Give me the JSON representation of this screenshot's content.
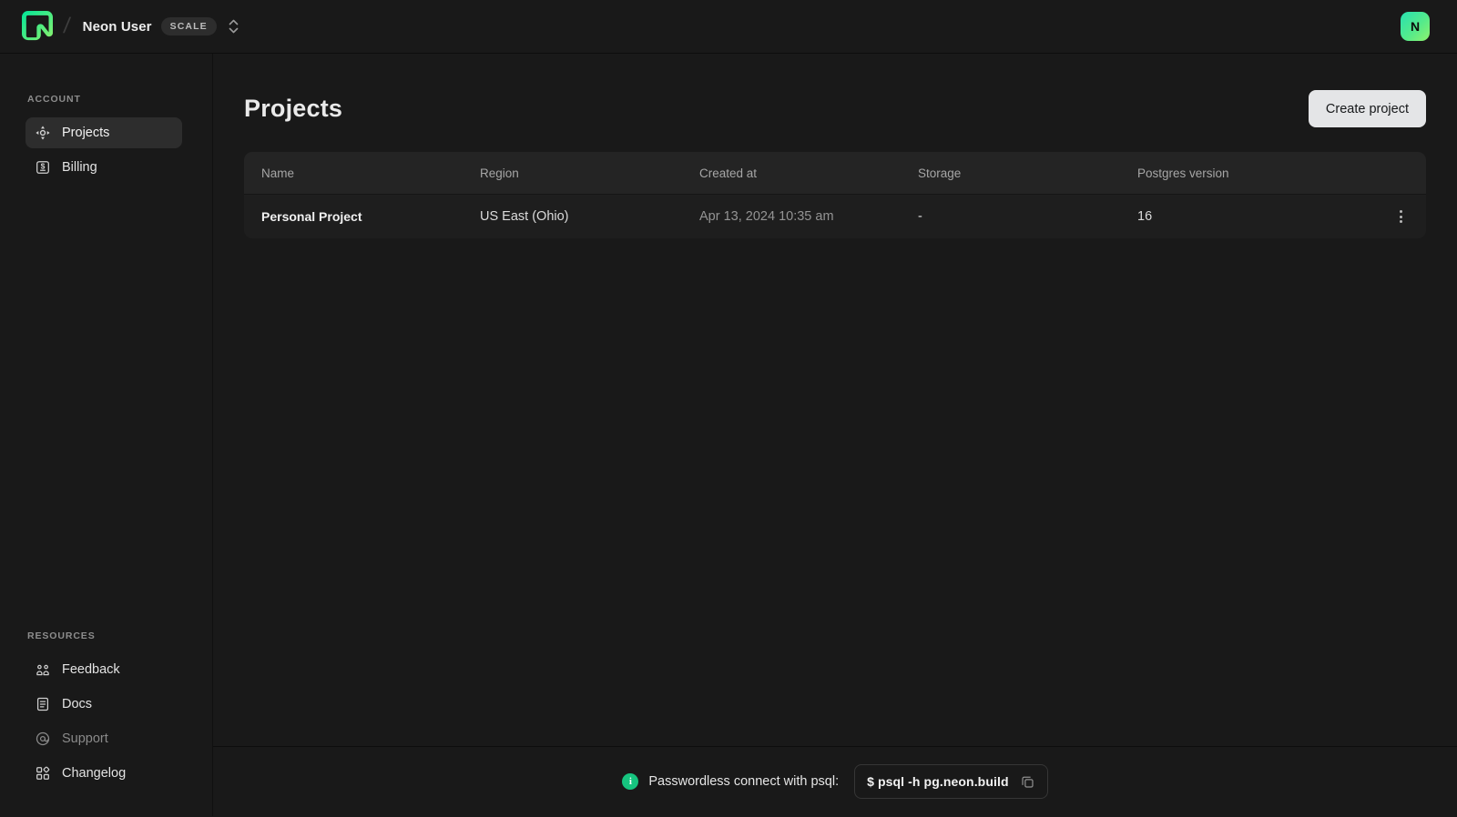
{
  "topbar": {
    "org_name": "Neon User",
    "plan_badge": "SCALE",
    "avatar_initial": "N"
  },
  "sidebar": {
    "account_section": {
      "label": "ACCOUNT",
      "items": [
        {
          "label": "Projects",
          "active": true
        },
        {
          "label": "Billing",
          "active": false
        }
      ]
    },
    "resources_section": {
      "label": "RESOURCES",
      "items": [
        {
          "label": "Feedback"
        },
        {
          "label": "Docs"
        },
        {
          "label": "Support"
        },
        {
          "label": "Changelog"
        }
      ]
    }
  },
  "main": {
    "title": "Projects",
    "create_button_label": "Create project",
    "table": {
      "columns": [
        "Name",
        "Region",
        "Created at",
        "Storage",
        "Postgres version"
      ],
      "rows": [
        {
          "name": "Personal Project",
          "region": "US East (Ohio)",
          "created_at": "Apr 13, 2024 10:35 am",
          "storage": "-",
          "postgres_version": "16"
        }
      ]
    }
  },
  "footer": {
    "info_label": "Passwordless connect with psql:",
    "command": "$ psql -h pg.neon.build"
  },
  "icons": {
    "logo": "neon-logo",
    "projects": "projects-compass-icon",
    "billing": "billing-dollar-icon",
    "feedback": "feedback-people-icon",
    "docs": "docs-document-icon",
    "support": "support-at-icon",
    "changelog": "changelog-grid-icon",
    "row_actions": "kebab-menu-icon",
    "info": "info-icon",
    "copy": "copy-icon",
    "org_switch": "chevron-up-down-icon"
  },
  "colors": {
    "brand_green": "#00e599",
    "background": "#191919",
    "table_header_bg": "#242424",
    "table_row_bg": "#1e1e1e",
    "active_item_bg": "#2d2d2d",
    "create_button_bg": "#e4e5e7",
    "create_button_text": "#16181a",
    "info_green": "#16c47f",
    "avatar_gradient_start": "#27e0b1",
    "avatar_gradient_end": "#8ff26d"
  }
}
